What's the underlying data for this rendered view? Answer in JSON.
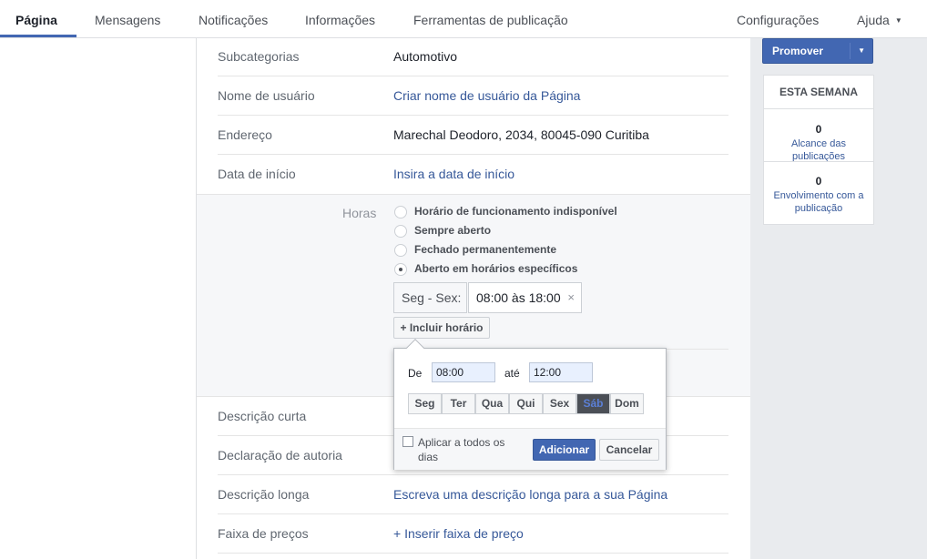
{
  "nav": {
    "tabs": [
      "Página",
      "Mensagens",
      "Notificações",
      "Informações",
      "Ferramentas de publicação"
    ],
    "right": [
      "Configurações",
      "Ajuda"
    ]
  },
  "fields": {
    "subcategories": {
      "label": "Subcategorias",
      "value": "Automotivo"
    },
    "username": {
      "label": "Nome de usuário",
      "value": "Criar nome de usuário da Página"
    },
    "address": {
      "label": "Endereço",
      "value": "Marechal Deodoro, 2034, 80045-090 Curitiba"
    },
    "start_date": {
      "label": "Data de início",
      "value": "Insira a data de início"
    },
    "short_desc": {
      "label": "Descrição curta"
    },
    "authorship": {
      "label": "Declaração de autoria"
    },
    "long_desc": {
      "label": "Descrição longa",
      "value": "Escreva uma descrição longa para a sua Página"
    },
    "price_range": {
      "label": "Faixa de preços",
      "value": "+ Inserir faixa de preço"
    }
  },
  "hours": {
    "label": "Horas",
    "options": [
      {
        "label": "Horário de funcionamento indisponível",
        "checked": false
      },
      {
        "label": "Sempre aberto",
        "checked": false
      },
      {
        "label": "Fechado permanentemente",
        "checked": false
      },
      {
        "label": "Aberto em horários específicos",
        "checked": true
      }
    ],
    "range_days": "Seg - Sex:",
    "range_time": "08:00 às 18:00",
    "remove_icon": "×",
    "add_button": "+ Incluir horário"
  },
  "popover": {
    "from_label": "De",
    "from_value": "08:00",
    "to_label": "até",
    "to_value": "12:00",
    "days": [
      "Seg",
      "Ter",
      "Qua",
      "Qui",
      "Sex",
      "Sáb",
      "Dom"
    ],
    "selected_day": "Sáb",
    "apply_all": "Aplicar a todos os dias",
    "add": "Adicionar",
    "cancel": "Cancelar"
  },
  "sidebar": {
    "promote": "Promover",
    "week_title": "ESTA SEMANA",
    "reach_value": "0",
    "reach_label": "Alcance das publicações",
    "engagement_value": "0",
    "engagement_label": "Envolvimento com a publicação"
  },
  "colors": {
    "accent": "#4267b2",
    "link": "#365899"
  }
}
